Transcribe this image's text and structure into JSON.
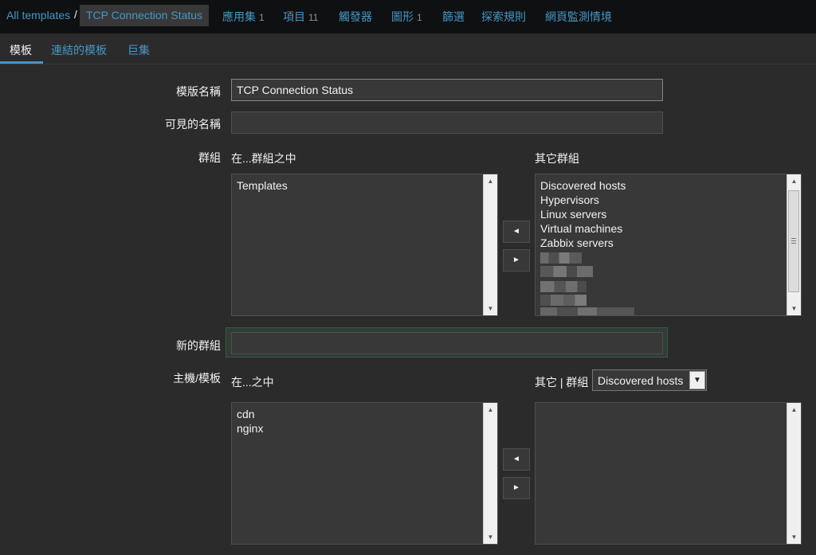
{
  "breadcrumb": {
    "root": "All templates",
    "separator": "/",
    "current": "TCP Connection Status",
    "items": [
      {
        "label": "應用集",
        "count": "1"
      },
      {
        "label": "項目",
        "count": "11"
      },
      {
        "label": "觸發器",
        "count": ""
      },
      {
        "label": "圖形",
        "count": "1"
      },
      {
        "label": "篩選",
        "count": ""
      },
      {
        "label": "探索規則",
        "count": ""
      },
      {
        "label": "網頁監測情境",
        "count": ""
      }
    ]
  },
  "tabs": [
    "模板",
    "連結的模板",
    "巨集"
  ],
  "form": {
    "template_name_label": "模版名稱",
    "template_name_value": "TCP Connection Status",
    "visible_name_label": "可見的名稱",
    "visible_name_value": "",
    "groups_label": "群組",
    "in_groups_label": "在...群組之中",
    "other_groups_label": "其它群組",
    "in_groups": [
      "Templates"
    ],
    "other_groups": [
      "Discovered hosts",
      "Hypervisors",
      "Linux servers",
      "Virtual machines",
      "Zabbix servers"
    ],
    "new_group_label": "新的群組",
    "new_group_value": "",
    "hosts_label": "主機/模板",
    "in_hosts_label": "在...之中",
    "other_group_label": "其它 | 群組",
    "other_group_select": "Discovered hosts",
    "in_hosts": [
      "cdn",
      "nginx"
    ],
    "other_hosts": []
  },
  "icons": {
    "move_left": "◄",
    "move_right": "►",
    "scroll_up": "▲",
    "scroll_down": "▼",
    "dropdown": "▼"
  },
  "colors": {
    "link": "#4796c4",
    "background": "#2b2b2b",
    "topbar": "#0e1012",
    "field": "#383838"
  }
}
